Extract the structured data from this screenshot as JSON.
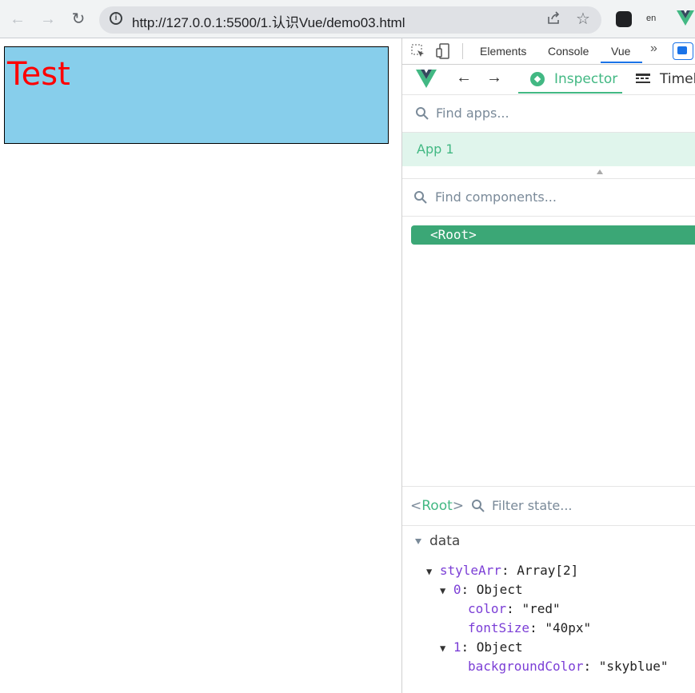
{
  "browser": {
    "url": "http://127.0.0.1:5500/1.认识Vue/demo03.html"
  },
  "page": {
    "test_text": "Test"
  },
  "devtools": {
    "tabs": [
      "Elements",
      "Console",
      "Vue"
    ],
    "active_tab": "Vue",
    "vue": {
      "inspector_label": "Inspector",
      "timeline_label": "Timeli",
      "find_apps_placeholder": "Find apps...",
      "app_name": "App 1",
      "find_components_placeholder": "Find components...",
      "root_component": "<Root>",
      "state_header_open": "<",
      "state_header_name": "Root",
      "state_header_close": ">",
      "filter_state_placeholder": "Filter state...",
      "section": "data",
      "state": {
        "styleArr_key": "styleArr",
        "styleArr_val": "Array[2]",
        "item0_key": "0",
        "item0_val": "Object",
        "color_key": "color",
        "color_val": "\"red\"",
        "fontSize_key": "fontSize",
        "fontSize_val": "\"40px\"",
        "item1_key": "1",
        "item1_val": "Object",
        "bg_key": "backgroundColor",
        "bg_val": "\"skyblue\""
      }
    }
  },
  "colors": {
    "vue_green": "#42b883",
    "selected_row": "#3ba776",
    "box_bg": "skyblue",
    "text_red": "red"
  }
}
